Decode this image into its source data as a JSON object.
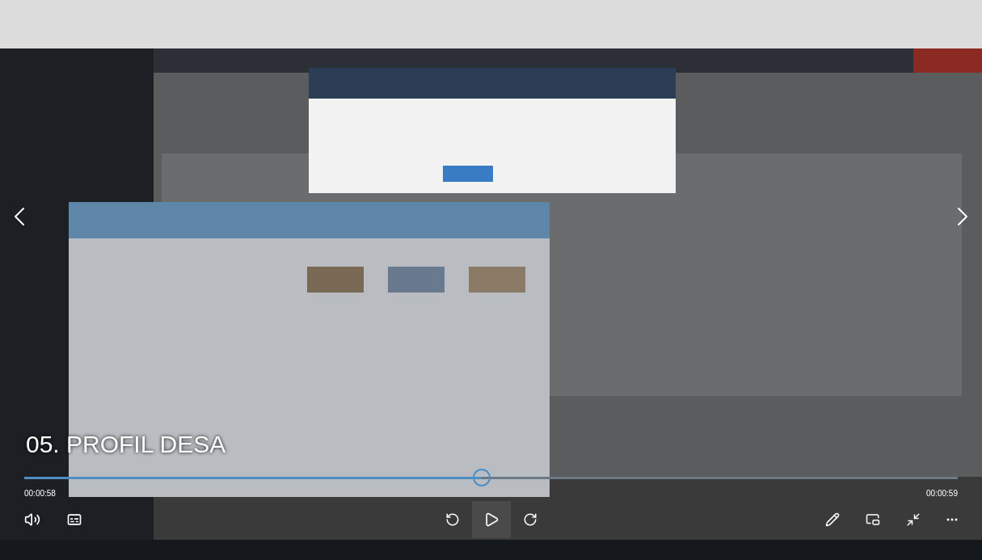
{
  "video": {
    "title": "05. PROFIL DESA"
  },
  "progress": {
    "level": 0.49,
    "elapsed": "00:00:58",
    "total": "00:00:59"
  },
  "playback": {
    "playing": false
  }
}
